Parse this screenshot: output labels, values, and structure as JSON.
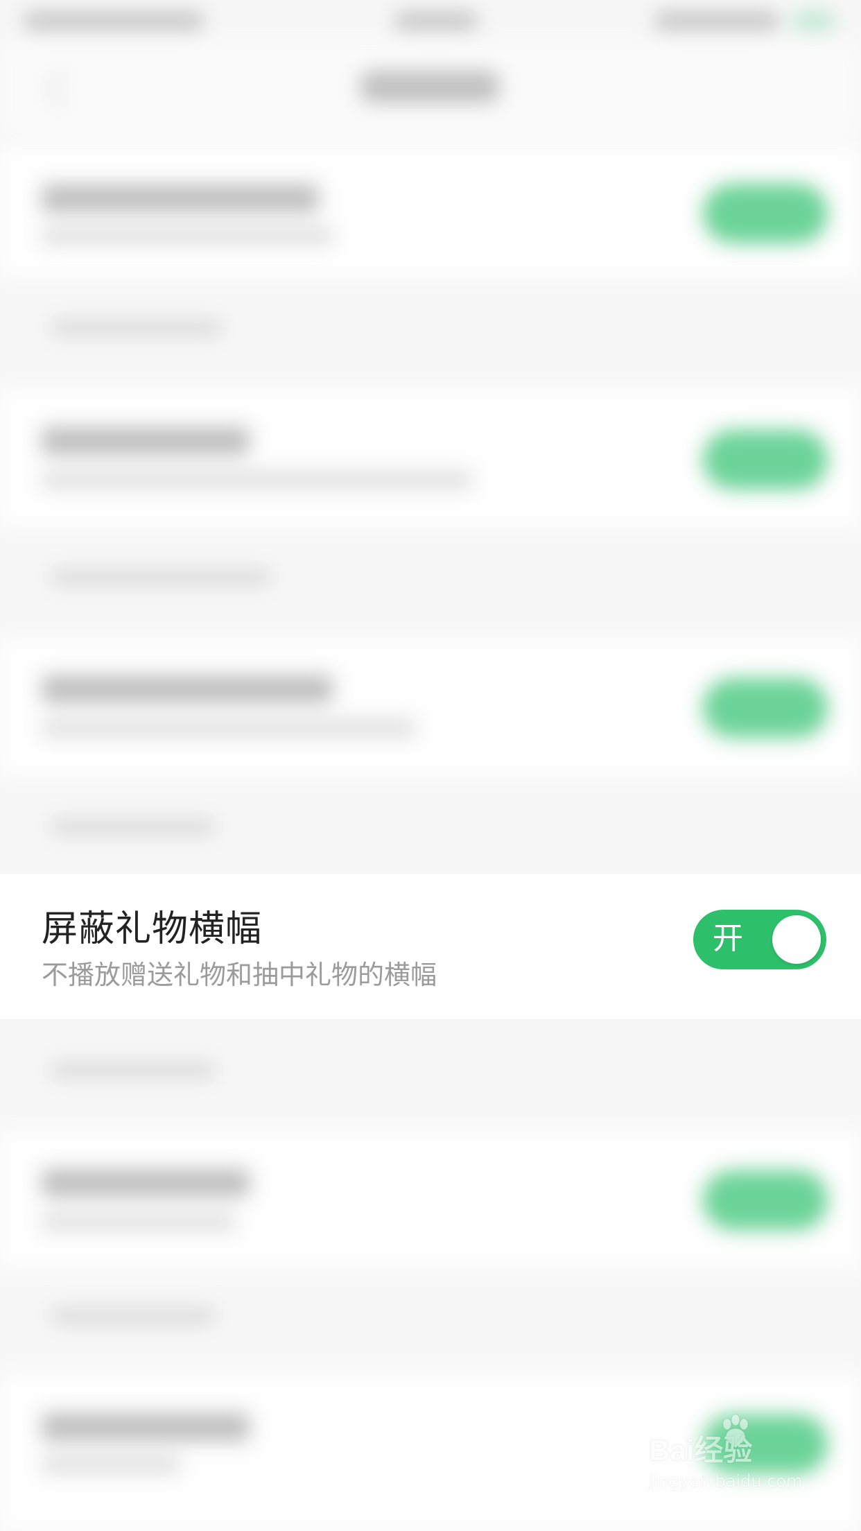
{
  "focus_setting": {
    "title": "屏蔽礼物横幅",
    "subtitle": "不播放赠送礼物和抽中礼物的横幅",
    "toggle_label": "开",
    "enabled": true
  },
  "watermark": {
    "brand": "Bai经验",
    "url": "jingyan.baidu.com"
  },
  "colors": {
    "accent_green": "#2dbf6a"
  },
  "icons": {
    "back": "back-chevron-icon"
  }
}
